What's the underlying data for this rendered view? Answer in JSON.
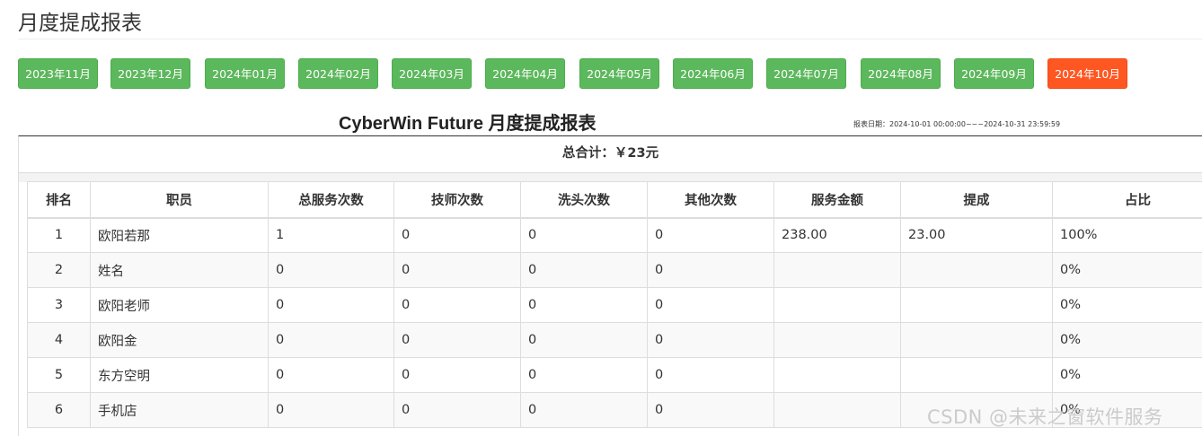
{
  "page_title": "月度提成报表",
  "months": [
    {
      "label": "2023年11月",
      "active": false
    },
    {
      "label": "2023年12月",
      "active": false
    },
    {
      "label": "2024年01月",
      "active": false
    },
    {
      "label": "2024年02月",
      "active": false
    },
    {
      "label": "2024年03月",
      "active": false
    },
    {
      "label": "2024年04月",
      "active": false
    },
    {
      "label": "2024年05月",
      "active": false
    },
    {
      "label": "2024年06月",
      "active": false
    },
    {
      "label": "2024年07月",
      "active": false
    },
    {
      "label": "2024年08月",
      "active": false
    },
    {
      "label": "2024年09月",
      "active": false
    },
    {
      "label": "2024年10月",
      "active": true
    }
  ],
  "report": {
    "title": "CyberWin Future 月度提成报表",
    "date_range": "报表日期：2024-10-01 00:00:00~~~2024-10-31 23:59:59",
    "total": "总合计：￥23元"
  },
  "table": {
    "headers": [
      "排名",
      "职员",
      "总服务次数",
      "技师次数",
      "洗头次数",
      "其他次数",
      "服务金额",
      "提成",
      "占比"
    ],
    "rows": [
      [
        "1",
        "欧阳若那",
        "1",
        "0",
        "0",
        "0",
        "238.00",
        "23.00",
        "100%"
      ],
      [
        "2",
        "姓名",
        "0",
        "0",
        "0",
        "0",
        "",
        "",
        "0%"
      ],
      [
        "3",
        "欧阳老师",
        "0",
        "0",
        "0",
        "0",
        "",
        "",
        "0%"
      ],
      [
        "4",
        "欧阳金",
        "0",
        "0",
        "0",
        "0",
        "",
        "",
        "0%"
      ],
      [
        "5",
        "东方空明",
        "0",
        "0",
        "0",
        "0",
        "",
        "",
        "0%"
      ],
      [
        "6",
        "手机店",
        "0",
        "0",
        "0",
        "0",
        "",
        "",
        "0%"
      ]
    ]
  },
  "watermark": "CSDN @未来之窗软件服务",
  "colors": {
    "month_button": "#5cb85c",
    "month_button_active": "#ff5722"
  }
}
